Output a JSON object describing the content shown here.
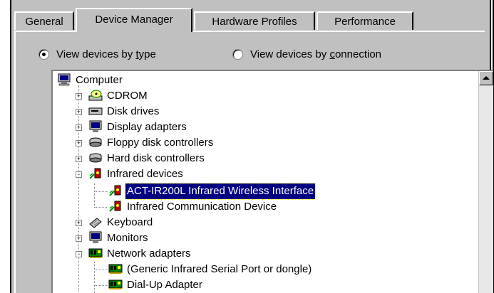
{
  "tabs": [
    {
      "label": "General",
      "active": false
    },
    {
      "label": "Device Manager",
      "active": true
    },
    {
      "label": "Hardware Profiles",
      "active": false
    },
    {
      "label": "Performance",
      "active": false
    }
  ],
  "view_options": {
    "by_type": {
      "prefix": "View devices by ",
      "accel": "t",
      "suffix": "ype",
      "checked": true
    },
    "by_connection": {
      "prefix": "View devices by ",
      "accel": "c",
      "suffix": "onnection",
      "checked": false
    }
  },
  "tree": {
    "root": {
      "label": "Computer",
      "icon": "computer-icon"
    },
    "items": [
      {
        "label": "CDROM",
        "icon": "cdrom-icon",
        "expander": "+"
      },
      {
        "label": "Disk drives",
        "icon": "disk-drive-icon",
        "expander": "+"
      },
      {
        "label": "Display adapters",
        "icon": "monitor-icon",
        "expander": "+"
      },
      {
        "label": "Floppy disk controllers",
        "icon": "disk-controller-icon",
        "expander": "+"
      },
      {
        "label": "Hard disk controllers",
        "icon": "disk-controller-icon",
        "expander": "+"
      },
      {
        "label": "Infrared devices",
        "icon": "infrared-icon",
        "expander": "-"
      },
      {
        "label": "ACT-IR200L Infrared Wireless Interface",
        "icon": "infrared-icon",
        "selected": true,
        "child": true
      },
      {
        "label": "Infrared Communication Device",
        "icon": "infrared-icon",
        "child": true
      },
      {
        "label": "Keyboard",
        "icon": "keyboard-icon",
        "expander": "+"
      },
      {
        "label": "Monitors",
        "icon": "monitor-icon",
        "expander": "+"
      },
      {
        "label": "Network adapters",
        "icon": "network-adapter-icon",
        "expander": "-"
      },
      {
        "label": "(Generic Infrared Serial Port or dongle)",
        "icon": "network-adapter-icon",
        "child": true
      },
      {
        "label": "Dial-Up Adapter",
        "icon": "network-adapter-icon",
        "child": true
      }
    ]
  },
  "colors": {
    "dialog_bg": "#c0c0c0",
    "selection_bg": "#000080",
    "selection_fg": "#ffffff"
  }
}
